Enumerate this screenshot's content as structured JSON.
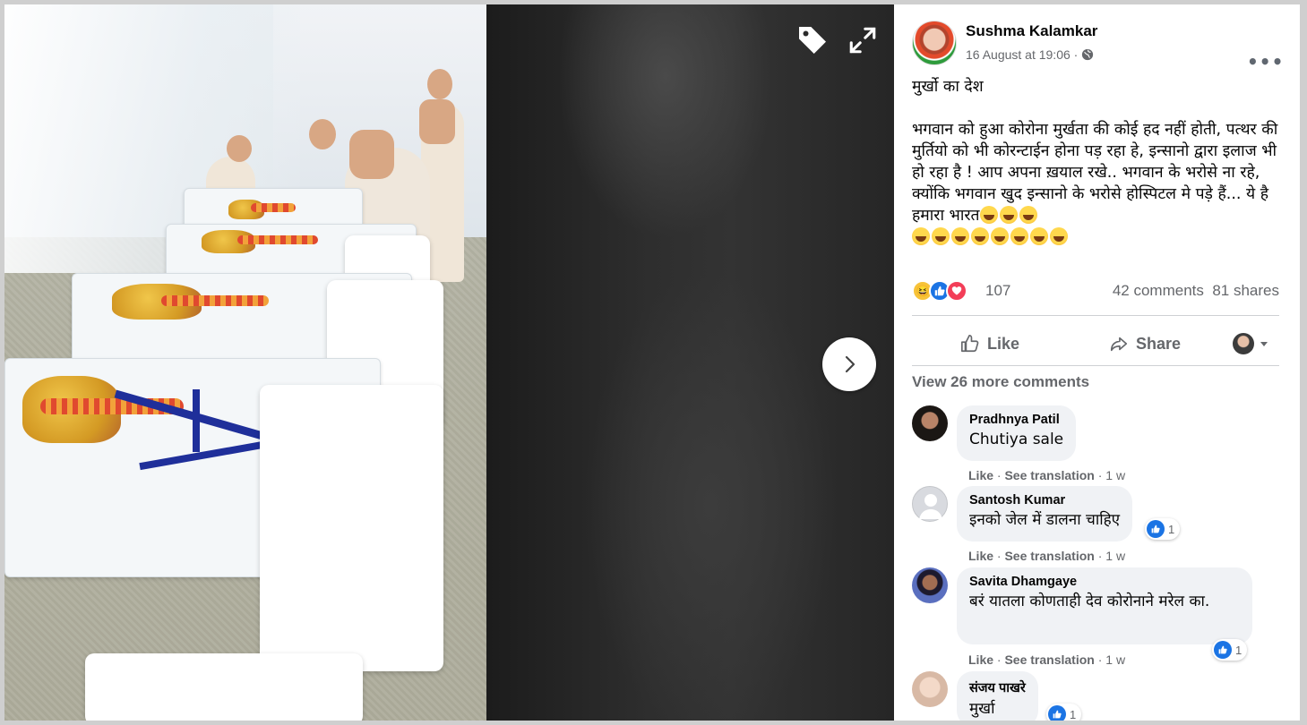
{
  "post": {
    "author": "Sushma Kalamkar",
    "timestamp": "16 August at 19:06 ·",
    "privacy_icon": "globe-icon",
    "more_label": "•••",
    "text": "मुर्खो का देश\n\nभगवान को हुआ कोरोना मुर्खता की कोई हद नहीं होती, पत्थर की मुर्तियो को भी कोरन्टाईन होना पड़ रहा हे, इन्सानो द्वारा इलाज भी हो रहा है ! आप अपना ख़याल रखे.. भगवान के भरोसे ना रहे, क्योंकि भगवान खुद इन्सानो के भरोसे होस्पिटल मे पड़े हैं... ये है हमारा भारत",
    "emoji_count_inline": 3,
    "emoji_count_line2": 8,
    "emoji_name": "face-with-tears-of-joy"
  },
  "stats": {
    "reaction_icons": [
      "haha",
      "like",
      "love"
    ],
    "reaction_count": "107",
    "comments": "42 comments",
    "shares": "81 shares"
  },
  "actions": {
    "like": "Like",
    "share": "Share"
  },
  "view_more": "View 26 more comments",
  "comments": [
    {
      "name": "Pradhnya Patil",
      "text": "Chutiya sale",
      "like": "Like",
      "translate": "See translation",
      "age": "1 w",
      "reactions": ""
    },
    {
      "name": "Santosh Kumar",
      "text": "इनको जेल में डालना चाहिए",
      "like": "Like",
      "translate": "See translation",
      "age": "1 w",
      "reactions": "1"
    },
    {
      "name": "Savita Dhamgaye",
      "text": "बरं यातला कोणताही देव कोरोनाने मरेल का.",
      "like": "Like",
      "translate": "See translation",
      "age": "1 w",
      "reactions": "1"
    },
    {
      "name": "संजय पाखरे",
      "text": "मुर्खा",
      "like": "",
      "translate": "",
      "age": "",
      "reactions": "1"
    }
  ],
  "viewer": {
    "tag_icon": "tag-icon",
    "expand_icon": "expand-icon",
    "next_icon": "chevron-right-icon"
  },
  "colors": {
    "accent": "#1b74e4",
    "secondary_text": "#65676b",
    "bubble": "#f0f2f5"
  }
}
